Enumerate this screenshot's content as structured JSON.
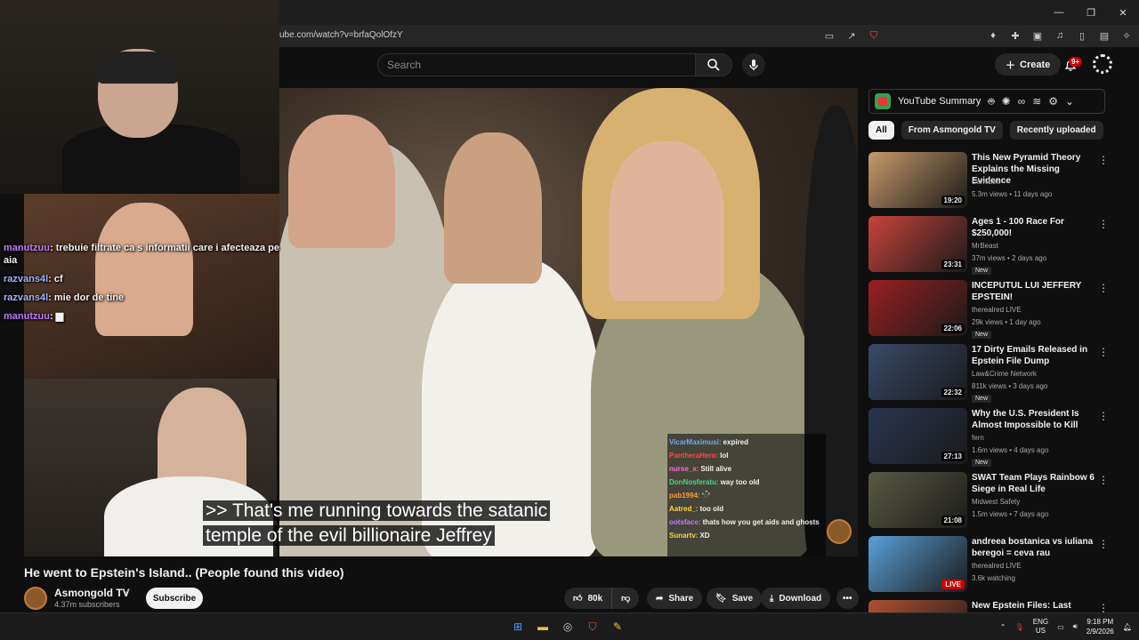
{
  "browser": {
    "url": "ube.com/watch?v=brfaQolOfzY",
    "window_controls": [
      "—",
      "❐",
      "✕"
    ]
  },
  "header": {
    "search_placeholder": "Search",
    "create_label": "Create",
    "notifications_badge": "9+"
  },
  "stream": {
    "left_chat": [
      {
        "name": "manutzuu",
        "message": "trebuie filtrate ca s informatii care i afecteaza pe aia",
        "color": "#c07bff"
      },
      {
        "name": "razvans4l",
        "message": "cf",
        "color": "#9fb4ff"
      },
      {
        "name": "razvans4l",
        "message": "mie dor de tine",
        "color": "#9fb4ff"
      },
      {
        "name": "manutzuu",
        "message": "▆",
        "color": "#c07bff"
      }
    ],
    "subtitle_line1": ">> That's me running towards the satanic",
    "subtitle_line2": "temple of the evil billionaire Jeffrey",
    "right_chat": [
      {
        "name": "VicarMaximusi:",
        "message": "expired",
        "color": "#6aa9ff"
      },
      {
        "name": "PantheraHero:",
        "message": "lol",
        "color": "#ff4a4a"
      },
      {
        "name": "nurse_x:",
        "message": "Still alive",
        "color": "#ff6ad5"
      },
      {
        "name": "DonNosferatu:",
        "message": "way too old",
        "color": "#4bd38a"
      },
      {
        "name": "pab1994:",
        "message": "ʻ◌̂ʼ",
        "color": "#ff9a3c"
      },
      {
        "name": "Aatred_:",
        "message": "too old",
        "color": "#ffd24a"
      },
      {
        "name": "ootsface:",
        "message": "thats how you get aids and ghosts",
        "color": "#c07bff"
      },
      {
        "name": "Sunartv:",
        "message": "XD",
        "color": "#ffd24a"
      }
    ]
  },
  "video": {
    "title": "He went to Epstein's Island.. (People found this video)",
    "channel": "Asmongold TV",
    "subscribers": "4.37m subscribers",
    "subscribe_label": "Subscribe",
    "likes": "80k",
    "share_label": "Share",
    "save_label": "Save",
    "download_label": "Download"
  },
  "sidebar": {
    "summary_label": "YouTube Summary",
    "chips": [
      "All",
      "From Asmongold TV",
      "Recently uploaded"
    ],
    "recommendations": [
      {
        "title": "This New Pyramid Theory Explains the Missing Evidence",
        "channel": "DamiLee",
        "meta": "5.3m views • 11 days ago",
        "duration": "19:20",
        "new": "",
        "thumb": "#c89a6a"
      },
      {
        "title": "Ages 1 - 100 Race For $250,000!",
        "channel": "MrBeast",
        "meta": "37m views • 2 days ago",
        "duration": "23:31",
        "new": "New",
        "thumb": "#c8443a"
      },
      {
        "title": "INCEPUTUL LUI JEFFERY EPSTEIN!",
        "channel": "therealred LIVE",
        "meta": "29k views • 1 day ago",
        "duration": "22:06",
        "new": "New",
        "thumb": "#9a2020"
      },
      {
        "title": "17 Dirty Emails Released in Epstein File Dump",
        "channel": "Law&Crime Network",
        "meta": "811k views • 3 days ago",
        "duration": "22:32",
        "new": "New",
        "thumb": "#3a4a6a"
      },
      {
        "title": "Why the U.S. President Is Almost Impossible to Kill",
        "channel": "fern",
        "meta": "1.6m views • 4 days ago",
        "duration": "27:13",
        "new": "New",
        "thumb": "#2a3550"
      },
      {
        "title": "SWAT Team Plays Rainbow 6 Siege in Real Life",
        "channel": "Midwest Safety",
        "meta": "1.5m views • 7 days ago",
        "duration": "21:08",
        "new": "",
        "thumb": "#5a5a44"
      },
      {
        "title": "andreea bostanica vs iuliana beregoi = ceva rau",
        "channel": "therealred LIVE",
        "meta": "3.6k watching",
        "duration": "LIVE",
        "new": "",
        "thumb": "#5aa0d8"
      },
      {
        "title": "New Epstein Files: Last Known Interview Body Language ...",
        "channel": "",
        "meta": "",
        "duration": "",
        "new": "",
        "thumb": "#b05030"
      }
    ]
  },
  "taskbar": {
    "lang_line1": "ENG",
    "lang_line2": "US",
    "time": "9:18 PM",
    "date": "2/9/2026"
  }
}
